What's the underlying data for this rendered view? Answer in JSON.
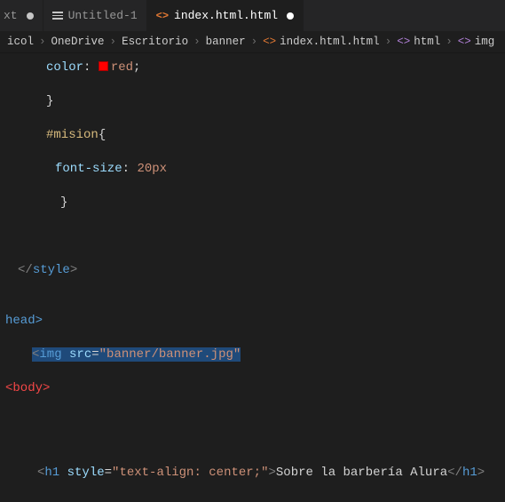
{
  "tabs": {
    "partial_suffix": "xt",
    "untitled": "Untitled-1",
    "active": "index.html.html"
  },
  "breadcrumbs": {
    "seg0_suffix": "icol",
    "seg1": "OneDrive",
    "seg2": "Escritorio",
    "seg3": "banner",
    "seg4": "index.html.html",
    "seg5": "html",
    "seg6": "img"
  },
  "code": {
    "color_prop": "color",
    "color_val": "red",
    "mision_sel": "#mision",
    "font_prop": "font-size",
    "font_val": "20px",
    "style_close": "</style>",
    "head_close": "head>",
    "img_open": "<img ",
    "img_attr": "src",
    "img_eq": "=",
    "img_val": "\"banner/banner.jpg\"",
    "body_open": "<body>",
    "h1_open_lt": "<",
    "h1_name": "h1",
    "h1_attr": "style",
    "h1_val": "\"text-align: center;\"",
    "h1_text": "Sobre la barbería Alura",
    "h1_close": "</",
    "h1_close_name": "h1",
    "h1_close_gt": ">"
  }
}
